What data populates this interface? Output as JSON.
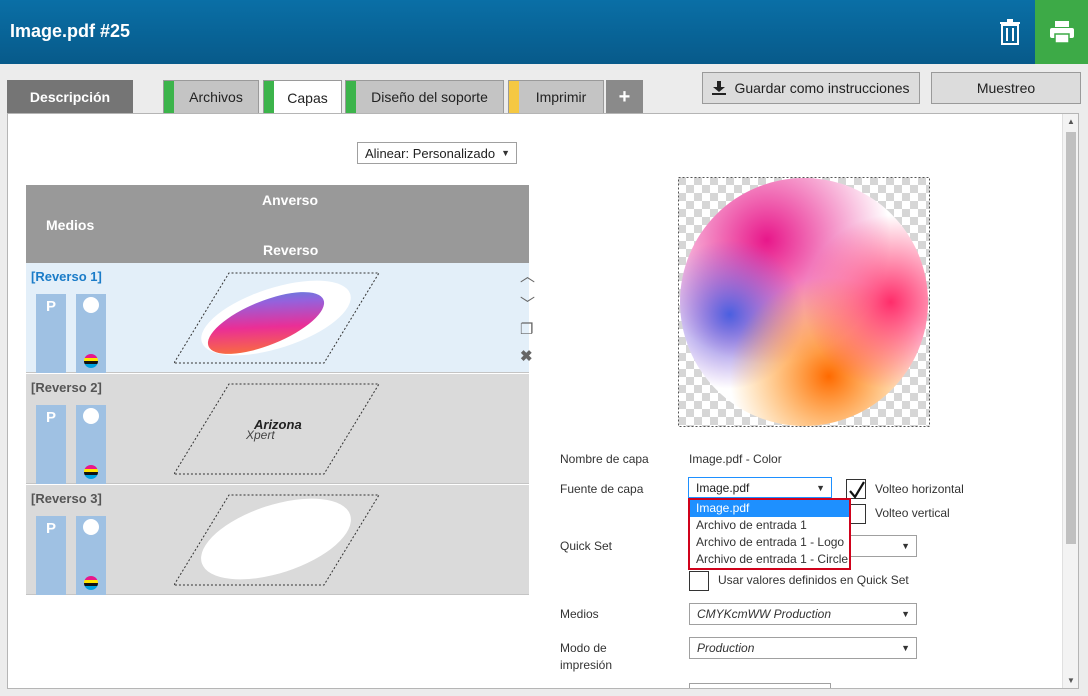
{
  "window": {
    "title": "Image.pdf #25"
  },
  "tabs": [
    {
      "label": "Descripción"
    },
    {
      "label": "Archivos"
    },
    {
      "label": "Capas"
    },
    {
      "label": "Diseño del soporte"
    },
    {
      "label": "Imprimir"
    },
    {
      "label": "+"
    }
  ],
  "header_buttons": {
    "save_instructions": "Guardar como instrucciones",
    "sample": "Muestreo"
  },
  "align_select": {
    "value": "Alinear: Personalizado"
  },
  "grid": {
    "medios": "Medios",
    "front": "Anverso",
    "back": "Reverso"
  },
  "layers": [
    {
      "label": "[Reverso 1]",
      "chip_p": "P"
    },
    {
      "label": "[Reverso 2]",
      "chip_p": "P",
      "content_text_1": "Arizona",
      "content_text_2": "Xpert"
    },
    {
      "label": "[Reverso 3]",
      "chip_p": "P"
    }
  ],
  "properties": {
    "layer_name_label": "Nombre de capa",
    "layer_name_value": "Image.pdf - Color",
    "layer_source_label": "Fuente de capa",
    "layer_source_value": "Image.pdf",
    "flip_horizontal": "Volteo horizontal",
    "flip_vertical": "Volteo vertical",
    "quick_set_label": "Quick Set",
    "use_quick_set": "Usar valores definidos en Quick Set",
    "media_label": "Medios",
    "media_value": "CMYKcmWW Production",
    "print_mode_label_1": "Modo de",
    "print_mode_label_2": "impresión",
    "print_mode_value": "Production"
  },
  "source_options": [
    "Image.pdf",
    "Archivo de entrada 1",
    "Archivo de entrada 1 - Logo",
    "Archivo de entrada 1 - Circle"
  ],
  "colors": {
    "accent": "#0a6fa6",
    "print_green": "#3daa47",
    "tab_green": "#3cb44b",
    "tab_yellow": "#f5c842",
    "highlight": "#1e90ff",
    "dropdown_border": "#d0021b"
  }
}
